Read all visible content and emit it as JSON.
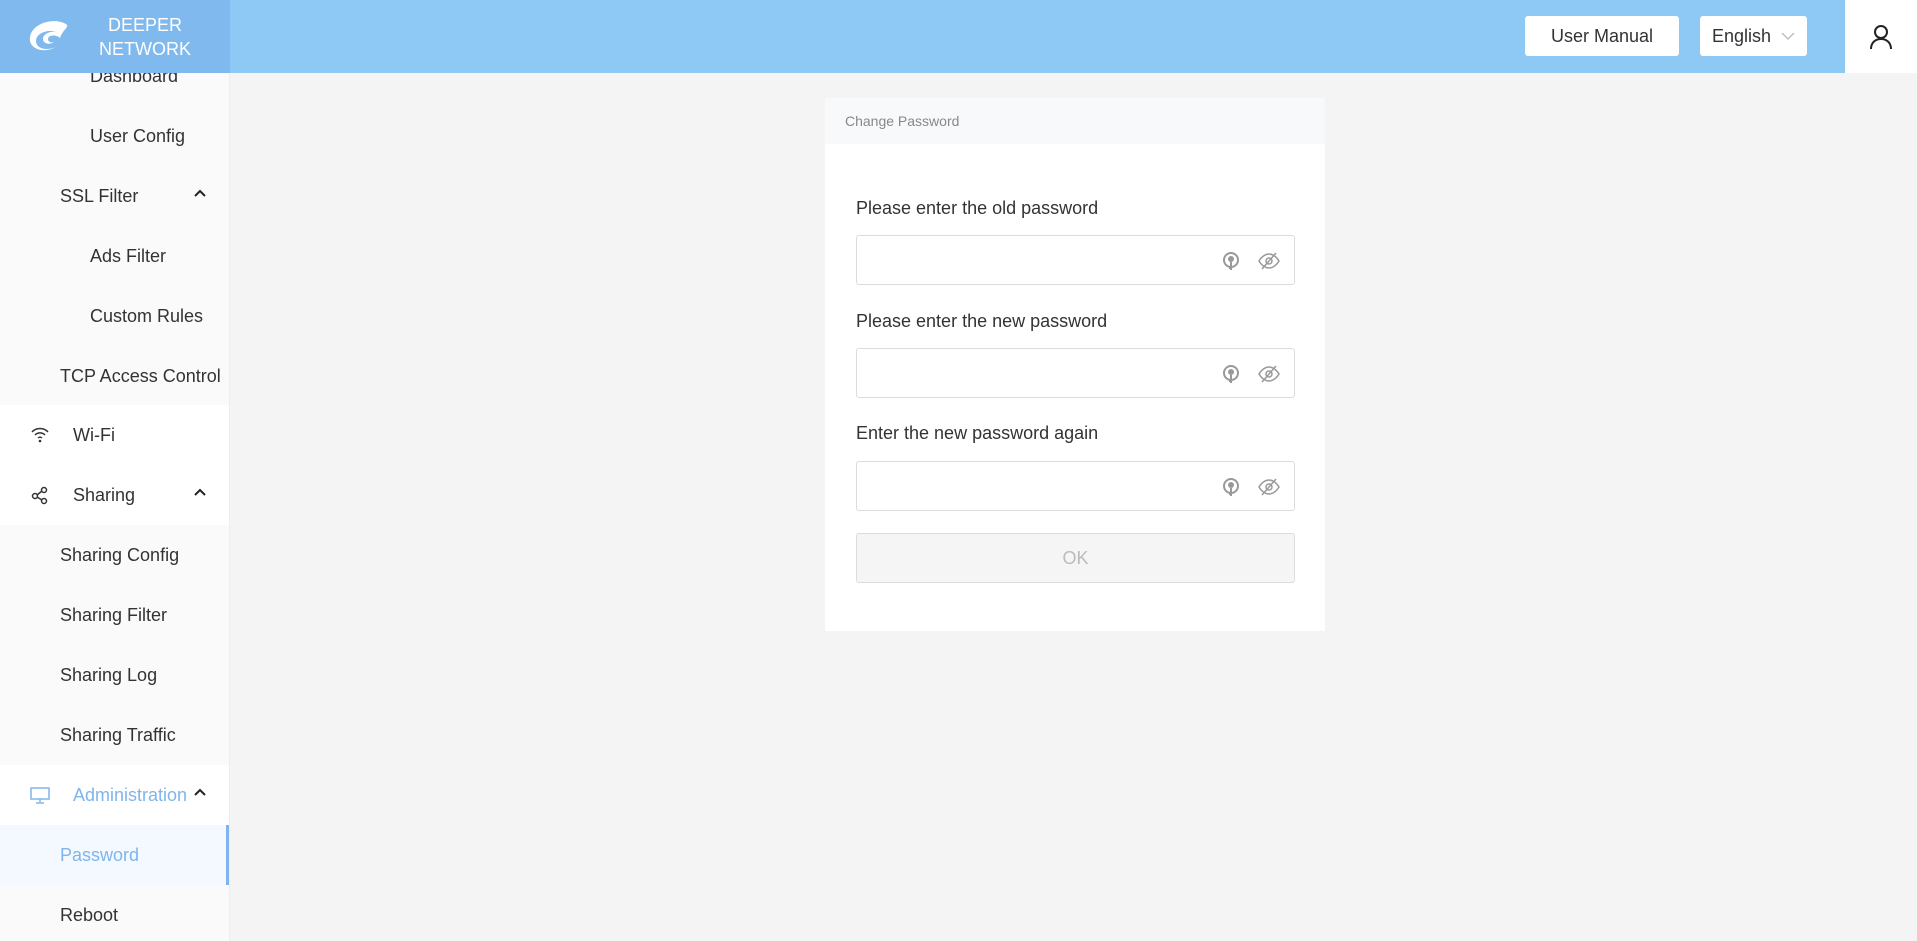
{
  "brand": {
    "line1": "DEEPER",
    "line2": "NETWORK"
  },
  "header": {
    "user_manual": "User Manual",
    "language": "English",
    "user_icon": "user-icon"
  },
  "sidebar": {
    "items": [
      {
        "label": "Dashboard",
        "level": 2
      },
      {
        "label": "User Config",
        "level": 2
      },
      {
        "label": "SSL Filter",
        "level": 1,
        "expanded": true
      },
      {
        "label": "Ads Filter",
        "level": 2
      },
      {
        "label": "Custom Rules",
        "level": 2
      },
      {
        "label": "TCP Access Control",
        "level": 1
      },
      {
        "label": "Wi-Fi",
        "icon": "wifi-icon"
      },
      {
        "label": "Sharing",
        "icon": "share-icon",
        "expanded": true
      },
      {
        "label": "Sharing Config"
      },
      {
        "label": "Sharing Filter"
      },
      {
        "label": "Sharing Log"
      },
      {
        "label": "Sharing Traffic"
      },
      {
        "label": "Administration",
        "icon": "monitor-icon",
        "expanded": true
      },
      {
        "label": "Password",
        "active": true
      },
      {
        "label": "Reboot"
      }
    ]
  },
  "card": {
    "title": "Change Password",
    "fields": [
      {
        "label": "Please enter the old password",
        "value": ""
      },
      {
        "label": "Please enter the new password",
        "value": ""
      },
      {
        "label": "Enter the new password again",
        "value": ""
      }
    ],
    "ok": "OK"
  },
  "colors": {
    "header": "#8ec8f5",
    "accent": "#7fb5ec"
  }
}
